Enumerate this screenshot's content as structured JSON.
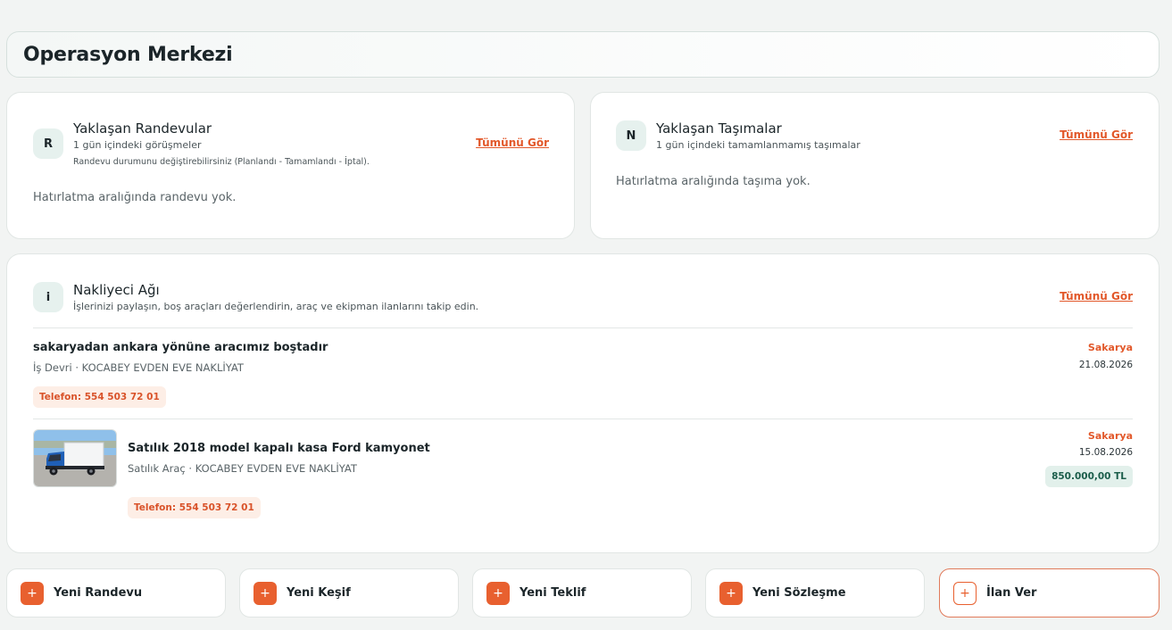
{
  "page_title": "Operasyon Merkezi",
  "appointments": {
    "badge": "R",
    "title": "Yaklaşan Randevular",
    "subtitle": "1 gün içindeki görüşmeler",
    "hint": "Randevu durumunu değiştirebilirsiniz (Planlandı - Tamamlandı - İptal).",
    "see_all": "Tümünü Gör",
    "empty": "Hatırlatma aralığında randevu yok."
  },
  "shipments": {
    "badge": "N",
    "title": "Yaklaşan Taşımalar",
    "subtitle": "1 gün içindeki tamamlanmamış taşımalar",
    "see_all": "Tümünü Gör",
    "empty": "Hatırlatma aralığında taşıma yok."
  },
  "network": {
    "badge": "i",
    "title": "Nakliyeci Ağı",
    "subtitle": "İşlerinizi paylaşın, boş araçları değerlendirin, araç ve ekipman ilanlarını takip edin.",
    "see_all": "Tümünü Gör",
    "posts": [
      {
        "title": "sakaryadan ankara yönüne aracımız boştadır",
        "meta": "İş Devri · KOCABEY EVDEN EVE NAKLİYAT",
        "phone": "Telefon: 554 503 72 01",
        "city": "Sakarya",
        "date": "21.08.2026"
      },
      {
        "title": "Satılık 2018 model kapalı kasa Ford kamyonet",
        "meta": "Satılık Araç · KOCABEY EVDEN EVE NAKLİYAT",
        "phone": "Telefon: 554 503 72 01",
        "city": "Sakarya",
        "date": "15.08.2026",
        "price": "850.000,00 TL",
        "image": "truck-photo"
      }
    ]
  },
  "actions": [
    {
      "label": "Yeni Randevu",
      "icon": "plus-icon"
    },
    {
      "label": "Yeni Keşif",
      "icon": "plus-icon"
    },
    {
      "label": "Yeni Teklif",
      "icon": "plus-icon"
    },
    {
      "label": "Yeni Sözleşme",
      "icon": "plus-icon"
    },
    {
      "label": "İlan Ver",
      "icon": "plus-icon"
    }
  ],
  "colors": {
    "accent": "#e8602f",
    "badge_bg": "#e6f1ee",
    "price_bg": "#e2f0eb",
    "price_text": "#1c5e4b"
  }
}
